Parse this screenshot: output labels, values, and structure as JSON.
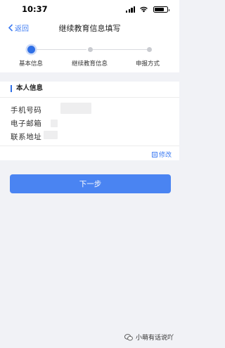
{
  "status_bar": {
    "time": "10:37"
  },
  "nav": {
    "back_label": "返回",
    "title": "继续教育信息填写"
  },
  "steps": [
    {
      "label": "基本信息",
      "active": true
    },
    {
      "label": "继续教育信息",
      "active": false
    },
    {
      "label": "申报方式",
      "active": false
    }
  ],
  "personal_info": {
    "section_title": "本人信息",
    "fields": [
      {
        "label": "手机号码",
        "value": ""
      },
      {
        "label": "电子邮箱",
        "value": ""
      },
      {
        "label": "联系地址",
        "value": ""
      }
    ],
    "edit_label": "修改"
  },
  "actions": {
    "next_label": "下一步"
  },
  "watermark": {
    "text": "小萌有话说吖"
  },
  "colors": {
    "accent": "#2f6fe6",
    "link": "#3d7bf2",
    "button": "#4a84f2",
    "page_bg": "#f1f2f6"
  },
  "icons": {
    "back": "chevron-left-icon",
    "edit": "edit-icon",
    "watermark": "wechat-icon"
  }
}
